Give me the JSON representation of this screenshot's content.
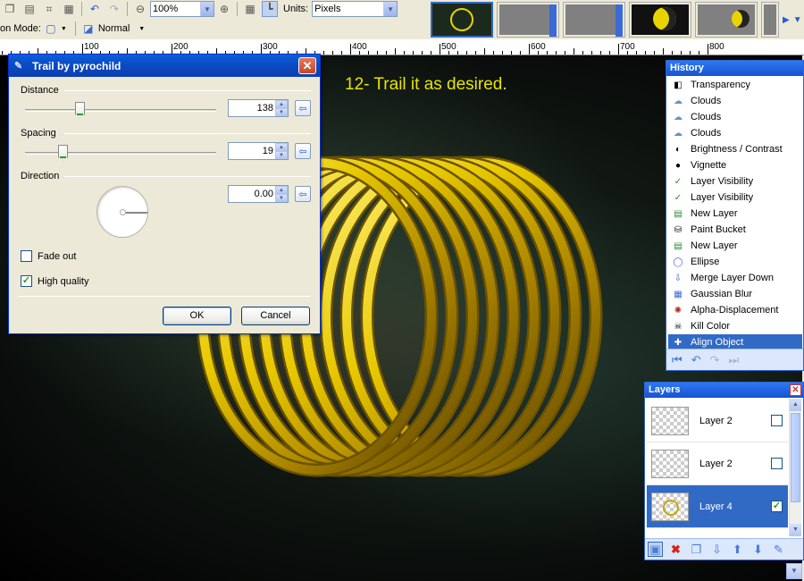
{
  "toolbar": {
    "zoom_value": "100%",
    "units_label": "Units:",
    "units_value": "Pixels",
    "mode_label": "on Mode:",
    "blend_value": "Normal"
  },
  "ruler": {
    "ticks": [
      "100",
      "200",
      "300",
      "400",
      "500",
      "600",
      "700",
      "800"
    ]
  },
  "canvas": {
    "caption": "12- Trail it as desired."
  },
  "dialog": {
    "title": "Trail by pyrochild",
    "distance_label": "Distance",
    "distance_value": "138",
    "spacing_label": "Spacing",
    "spacing_value": "19",
    "direction_label": "Direction",
    "direction_value": "0.00",
    "fade_out_label": "Fade out",
    "fade_out_checked": false,
    "high_quality_label": "High quality",
    "high_quality_checked": true,
    "ok_label": "OK",
    "cancel_label": "Cancel",
    "close_glyph": "✕",
    "check_glyph": "✓"
  },
  "history": {
    "title": "History",
    "items": [
      {
        "label": "Transparency",
        "icon": "transparency-icon"
      },
      {
        "label": "Clouds",
        "icon": "clouds-icon"
      },
      {
        "label": "Clouds",
        "icon": "clouds-icon"
      },
      {
        "label": "Clouds",
        "icon": "clouds-icon"
      },
      {
        "label": "Brightness / Contrast",
        "icon": "brightness-contrast-icon"
      },
      {
        "label": "Vignette",
        "icon": "vignette-icon"
      },
      {
        "label": "Layer Visibility",
        "icon": "layer-visibility-icon"
      },
      {
        "label": "Layer Visibility",
        "icon": "layer-visibility-icon"
      },
      {
        "label": "New Layer",
        "icon": "new-layer-icon"
      },
      {
        "label": "Paint Bucket",
        "icon": "paint-bucket-icon"
      },
      {
        "label": "New Layer",
        "icon": "new-layer-icon"
      },
      {
        "label": "Ellipse",
        "icon": "ellipse-icon"
      },
      {
        "label": "Merge Layer Down",
        "icon": "merge-layer-down-icon"
      },
      {
        "label": "Gaussian Blur",
        "icon": "gaussian-blur-icon"
      },
      {
        "label": "Alpha-Displacement",
        "icon": "alpha-displacement-icon"
      },
      {
        "label": "Kill Color",
        "icon": "kill-color-icon"
      },
      {
        "label": "Align Object",
        "icon": "align-object-icon",
        "selected": true
      }
    ]
  },
  "layers": {
    "title": "Layers",
    "items": [
      {
        "name": "Layer 2",
        "visible": false,
        "selected": false
      },
      {
        "name": "Layer 2",
        "visible": false,
        "selected": false
      },
      {
        "name": "Layer 4",
        "visible": true,
        "selected": true
      }
    ]
  },
  "colors": {
    "ring_gold": "#e8c800",
    "ring_dark": "#6b5200",
    "caption_yellow": "#e6e600",
    "xp_blue": "#0a4bc4",
    "selection_blue": "#316ac5"
  }
}
